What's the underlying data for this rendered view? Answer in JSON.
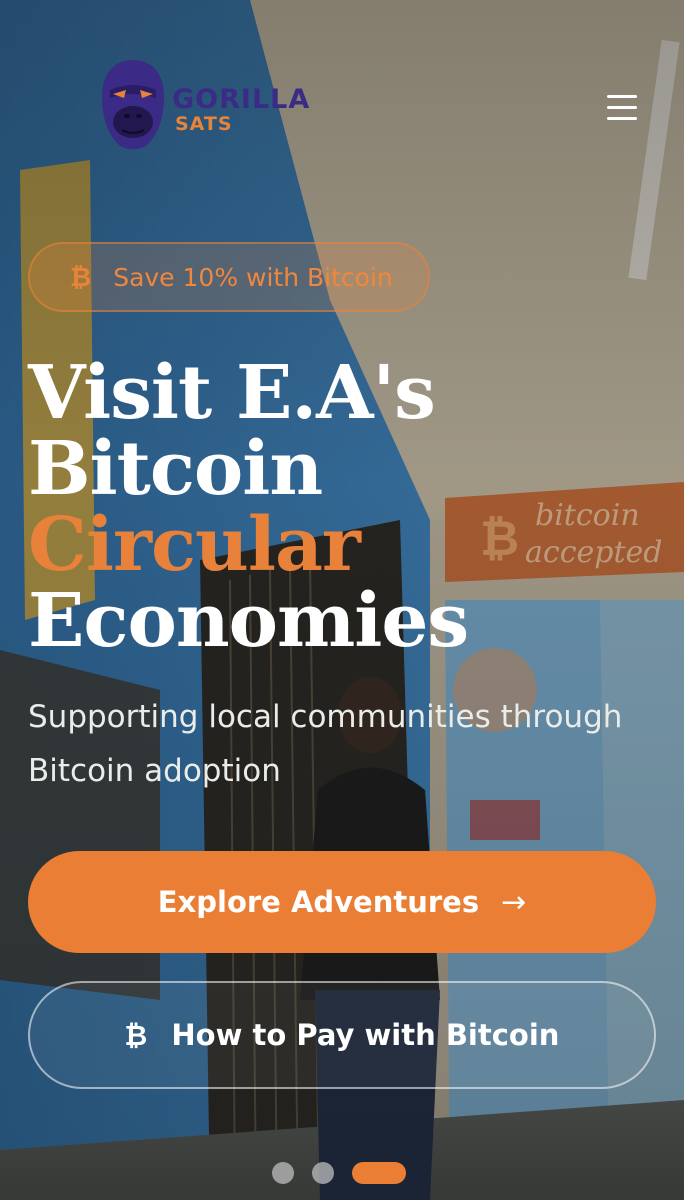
{
  "brand": {
    "name_line1": "GORILLA",
    "name_line2": "SATS",
    "logo_icon": "gorilla-logo-icon",
    "primary_color": "#3b2a86",
    "accent_color": "#e8843a"
  },
  "header": {
    "menu_icon": "hamburger-menu-icon"
  },
  "promo_badge": {
    "icon": "bitcoin-icon",
    "symbol": "₿",
    "label": "Save 10% with Bitcoin"
  },
  "hero": {
    "title_line1": "Visit E.A's",
    "title_line2": "Bitcoin",
    "title_line3": "Circular",
    "title_line4": "Economies",
    "subtitle": "Supporting local communities through Bitcoin adoption",
    "background_sign": "bitcoin accepted"
  },
  "actions": {
    "primary_label": "Explore Adventures",
    "primary_icon": "arrow-right-icon",
    "arrow_symbol": "→",
    "secondary_label": "How to Pay with Bitcoin",
    "secondary_icon": "bitcoin-icon",
    "secondary_symbol": "₿"
  },
  "carousel": {
    "slide_count": 3,
    "active_slide": 3
  }
}
